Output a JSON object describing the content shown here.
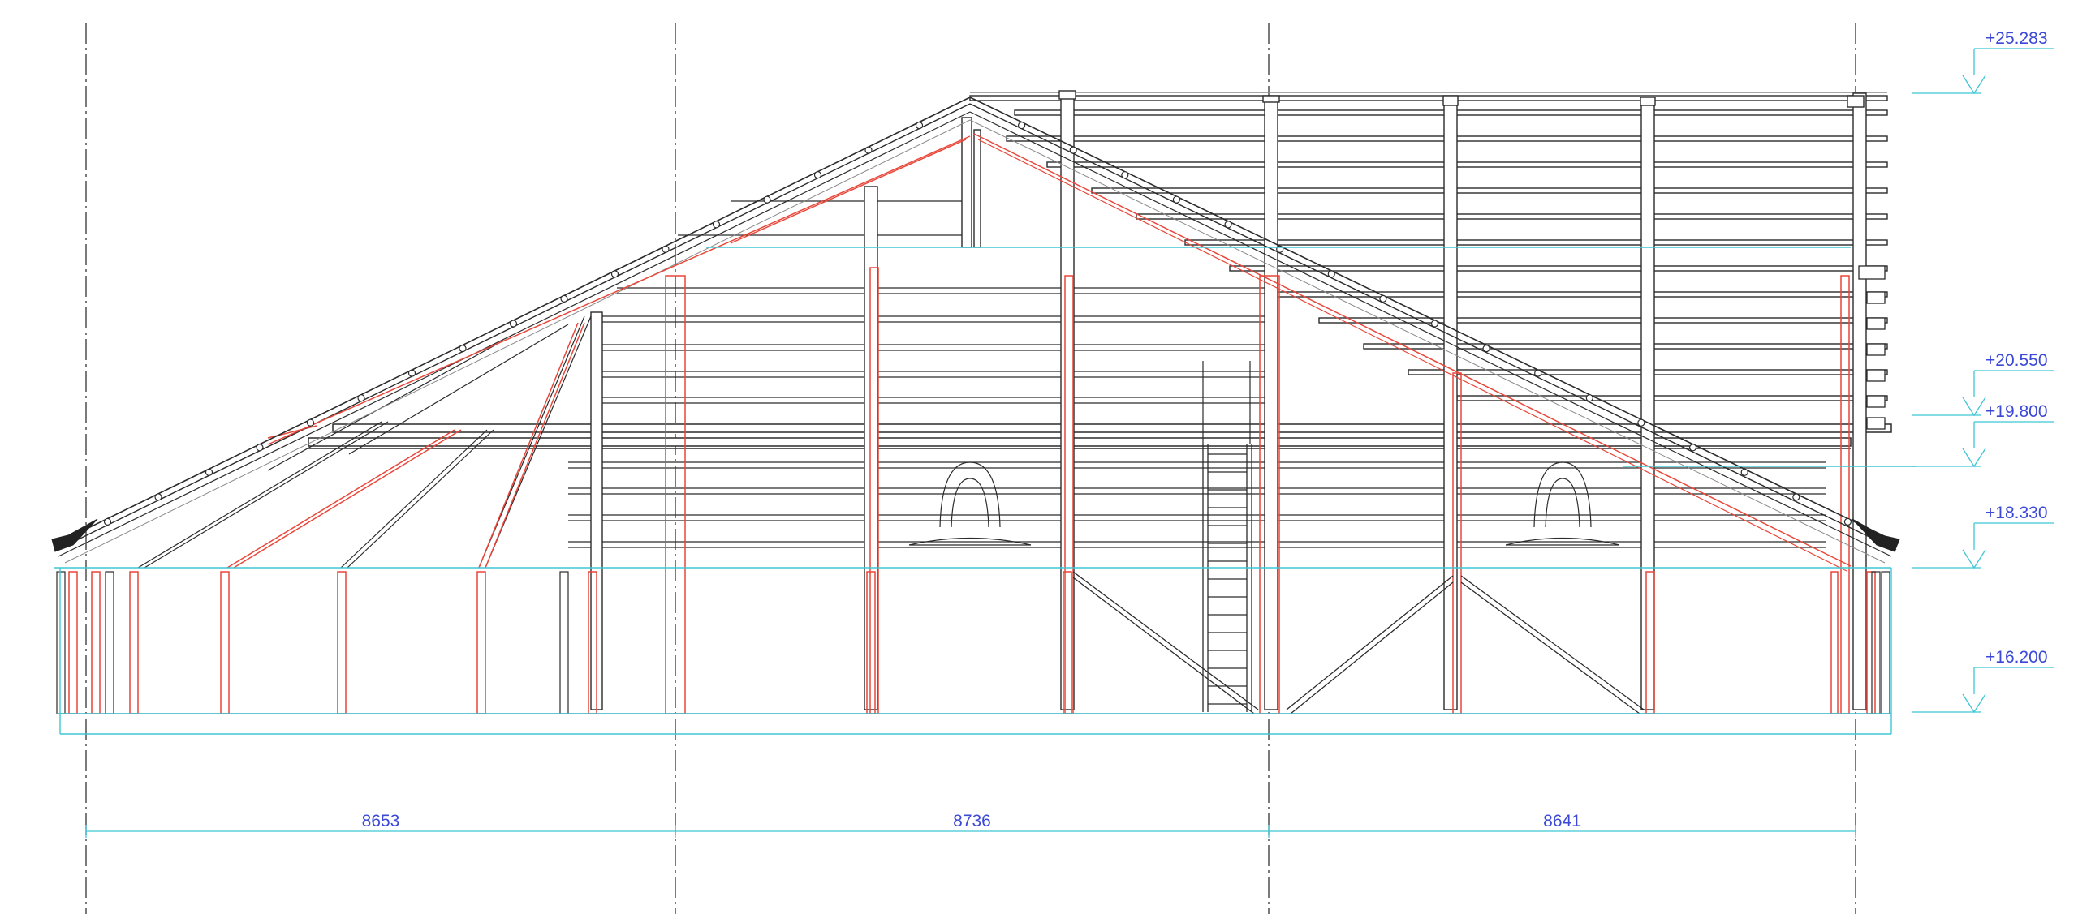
{
  "colors": {
    "background": "#ffffff",
    "structure": "#2b2b2b",
    "structure_light": "#8a8a8a",
    "highlight": "#e8473a",
    "annotation": "#3b49d6",
    "guide": "#3fc6d4",
    "axis": "#333333"
  },
  "elevations": [
    {
      "label": "+25.283"
    },
    {
      "label": "+20.550"
    },
    {
      "label": "+19.800"
    },
    {
      "label": "+18.330"
    },
    {
      "label": "+16.200"
    }
  ],
  "dimensions": [
    {
      "label": "8653"
    },
    {
      "label": "8736"
    },
    {
      "label": "8641"
    }
  ]
}
